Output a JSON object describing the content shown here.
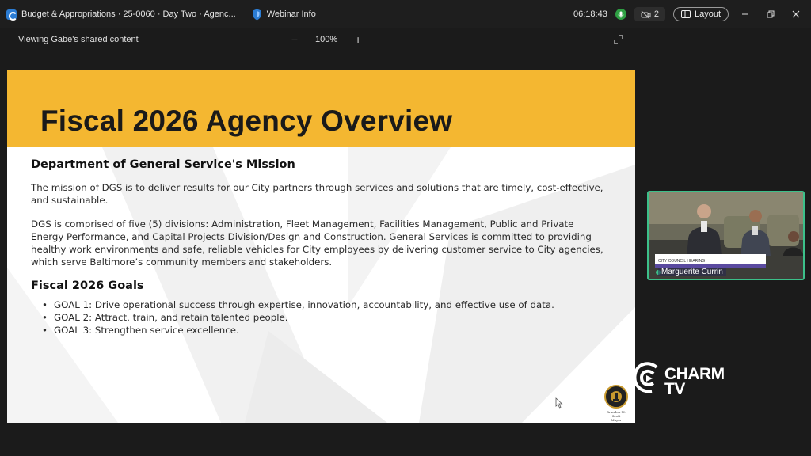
{
  "titlebar": {
    "meeting_title": "Budget & Appropriations · 25-0060 · Day Two · Agenc...",
    "webinar_info": "Webinar Info",
    "timer": "06:18:43",
    "people_count": "2",
    "layout_label": "Layout"
  },
  "sharebar": {
    "share_label": "Viewing Gabe's shared content",
    "zoom_level": "100%",
    "zoom_out": "−",
    "zoom_in": "+"
  },
  "slide": {
    "title": "Fiscal 2026 Agency Overview",
    "mission_heading": "Department of General Service's Mission",
    "mission_para1": "The mission of DGS is to deliver results for our City partners through services and solutions that are timely, cost-effective, and sustainable.",
    "mission_para2": "DGS is comprised of five (5) divisions: Administration, Fleet Management, Facilities Management, Public and Private Energy Performance, and Capital Projects Division/Design and Construction. General Services is committed to providing healthy work environments and safe, reliable vehicles for City employees by delivering customer service to City agencies, which serve Baltimore’s community members and stakeholders.",
    "goals_heading": "Fiscal 2026 Goals",
    "goals": [
      "GOAL 1: Drive operational success through expertise, innovation, accountability, and effective use of data.",
      "GOAL 2: Attract, train, and retain talented people.",
      "GOAL 3: Strengthen service excellence."
    ],
    "seal_caption_line1": "Brandon M. Scott",
    "seal_caption_line2": "Mayor",
    "header_color": "#f4b731"
  },
  "video": {
    "participant_name": "Marguerite Currin",
    "lower_third_line1": "CITY COUNCIL HEARING",
    "border_color": "#3cc08a"
  },
  "watermark": {
    "line1": "CHARM",
    "line2": "TV"
  }
}
